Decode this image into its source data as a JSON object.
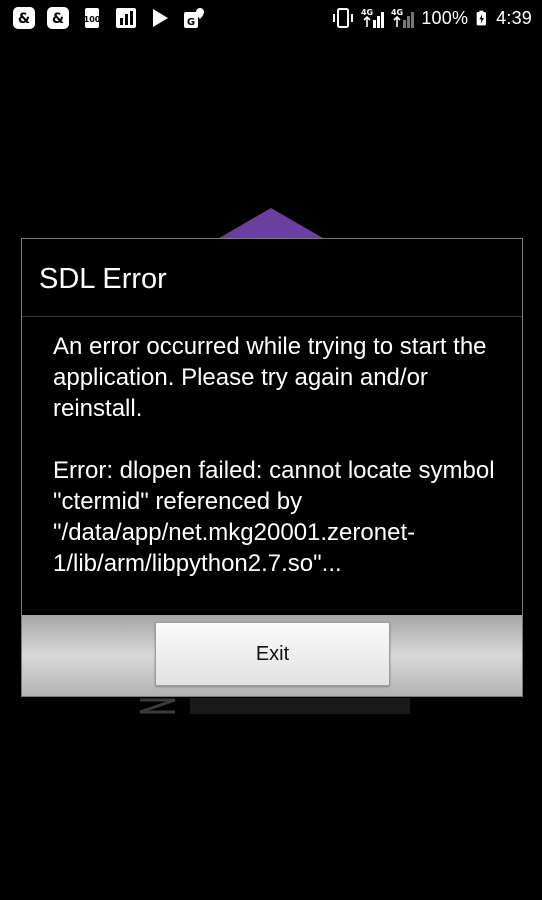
{
  "status_bar": {
    "left_icons": [
      "app-s-icon",
      "app-s-icon",
      "speed-100-icon",
      "stats-icon",
      "play-store-icon",
      "location-g-icon"
    ],
    "right_icons": [
      "vibrate-icon",
      "signal-4g-icon",
      "signal-4g-icon",
      "battery-charging-icon"
    ],
    "battery": "100%",
    "time": "4:39"
  },
  "dialog": {
    "title": "SDL Error",
    "message": "An error occurred while trying to start the application. Please try again and/or reinstall.\n\nError: dlopen failed: cannot locate symbol \"ctermid\" referenced by \"/data/app/net.mkg20001.zeronet-1/lib/arm/libpython2.7.so\"...",
    "exit_label": "Exit"
  }
}
